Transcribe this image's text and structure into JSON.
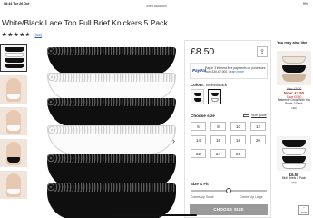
{
  "status": {
    "time": "08:44 Tue 26 Oct",
    "url": "direct.asda.com",
    "battery": "9%"
  },
  "product": {
    "title": "White/Black Lace Top Full Brief Knickers 5 Pack",
    "rating_count": "(13)",
    "price": "£8.50",
    "paypal": {
      "logo": "PayPal",
      "text": "Pay in 3 interest-free payments on purchases from £30-£2,000.",
      "learn_more": "Learn more"
    },
    "colour_label": "Colour:",
    "colour_value": "White/Black",
    "choose_size": "Choose size",
    "size_guide": "Size guide",
    "sizes": [
      "6",
      "8",
      "10",
      "12",
      "14",
      "16",
      "18",
      "20",
      "22",
      "24",
      "26"
    ],
    "size_fit": "Size & Fit",
    "fit_left": "Comes Up Small",
    "fit_right": "Comes Up Large",
    "choose_size_button": "CHOOSE SIZE",
    "fit_level": 0.5
  },
  "also_like": {
    "header": "You may also like",
    "items": [
      {
        "was": "Was: £8.00",
        "now": "Now: £7.50",
        "save": "Save £0.50",
        "name": "Maternity Grow With You Briefs 2 Pack",
        "rating": "(40)"
      },
      {
        "now": "£6.50",
        "name": "Midi Briefs 5 Pack",
        "rating": "(27)"
      }
    ]
  },
  "top_button": "TOP"
}
